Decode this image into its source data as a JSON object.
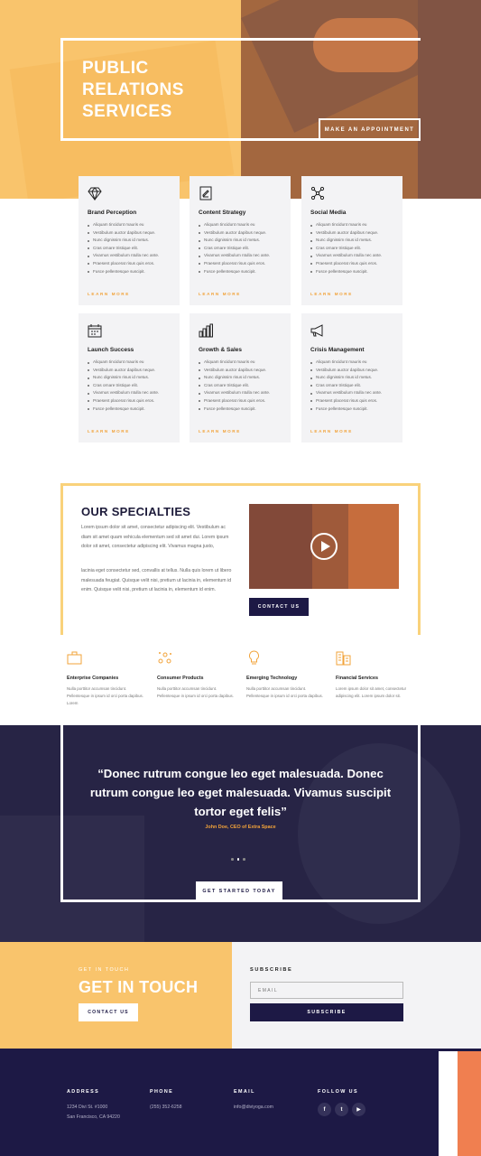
{
  "hero": {
    "title": "PUBLIC RELATIONS SERVICES",
    "cta": "MAKE AN APPOINTMENT"
  },
  "services": [
    {
      "title": "Brand Perception",
      "icon": "diamond-icon",
      "items": [
        "Aliquam tincidunt mauris eu",
        "Vestibulum auctor dapibus neque.",
        "Nunc dignissim risus id metus.",
        "Cras ornare tristique elit.",
        "Vivamus vestibulum ntulla nec ante.",
        "Praesent placerat risus quis eros.",
        "Fusce pellentesque suscipit."
      ],
      "more": "LEARN MORE"
    },
    {
      "title": "Content Strategy",
      "icon": "document-icon",
      "items": [
        "Aliquam tincidunt mauris eu",
        "Vestibulum auctor dapibus neque.",
        "Nunc dignissim risus id metus.",
        "Cras ornare tristique elit.",
        "Vivamus vestibulum ntulla nec ante.",
        "Praesent placerat risus quis eros.",
        "Fusce pellentesque suscipit."
      ],
      "more": "LEARN MORE"
    },
    {
      "title": "Social Media",
      "icon": "network-icon",
      "items": [
        "Aliquam tincidunt mauris eu",
        "Vestibulum auctor dapibus neque.",
        "Nunc dignissim risus id metus.",
        "Cras ornare tristique elit.",
        "Vivamus vestibulum ntulla nec ante.",
        "Praesent placerat risus quis eros.",
        "Fusce pellentesque suscipit."
      ],
      "more": "LEARN MORE"
    },
    {
      "title": "Launch Success",
      "icon": "calendar-icon",
      "items": [
        "Aliquam tincidunt mauris eu",
        "Vestibulum auctor dapibus neque.",
        "Nunc dignissim risus id metus.",
        "Cras ornare tristique elit.",
        "Vivamus vestibulum ntulla nec ante.",
        "Praesent placerat risus quis eros.",
        "Fusce pellentesque suscipit."
      ],
      "more": "LEARN MORE"
    },
    {
      "title": "Growth & Sales",
      "icon": "bar-chart-icon",
      "items": [
        "Aliquam tincidunt mauris eu",
        "Vestibulum auctor dapibus neque.",
        "Nunc dignissim risus id metus.",
        "Cras ornare tristique elit.",
        "Vivamus vestibulum ntulla nec ante.",
        "Praesent placerat risus quis eros.",
        "Fusce pellentesque suscipit."
      ],
      "more": "LEARN MORE"
    },
    {
      "title": "Crisis Management",
      "icon": "megaphone-icon",
      "items": [
        "Aliquam tincidunt mauris eu",
        "Vestibulum auctor dapibus neque.",
        "Nunc dignissim risus id metus.",
        "Cras ornare tristique elit.",
        "Vivamus vestibulum ntulla nec ante.",
        "Praesent placerat risus quis eros.",
        "Fusce pellentesque suscipit."
      ],
      "more": "LEARN MORE"
    }
  ],
  "specialties": {
    "title": "OUR SPECIALTIES",
    "p1": "Lorem ipsum dolor sit amet, consectetur adipiscing elit. Vestibulum ac diam sit amet quam vehicula elementum sed sit amet dui. Lorem ipsum dolor sit amet, consectetur adipiscing elit. Vivamus magna justo,",
    "p2": "lacinia eget consectetur sed, convallis at tellus. Nulla quis lorem ut libero malesuada feugiat. Quisque velit nisi, pretium ut lacinia in, elementum id enim. Quisque velit nisi, pretium ut lacinia in, elementum id enim.",
    "contact": "CONTACT US"
  },
  "features": [
    {
      "title": "Enterprise Companies",
      "icon": "briefcase-icon",
      "text": "Nulla porttitor accumsan tincidunt. Pellentesque in ipsum id orci porta dapibus. Lorem"
    },
    {
      "title": "Consumer Products",
      "icon": "molecule-icon",
      "text": "Nulla porttitor accumsan tincidunt. Pellentesque in ipsum id orci porta dapibus."
    },
    {
      "title": "Emerging Technology",
      "icon": "lightbulb-icon",
      "text": "Nulla porttitor accumsan tincidunt. Pellentesque in ipsum id orci porta dapibus."
    },
    {
      "title": "Financial Services",
      "icon": "buildings-icon",
      "text": "Lorem ipsum dolor sit amet, consectetur adipiscing elit. Lorem ipsum dolor sit."
    }
  ],
  "testimonial": {
    "quote": "“Donec rutrum congue leo eget malesuada. Donec rutrum congue leo eget malesuada. Vivamus suscipit tortor eget felis”",
    "author": "John Doe, CEO of Extra Space",
    "cta": "GET STARTED TODAY"
  },
  "get_in_touch": {
    "eyebrow": "GET IN TOUCH",
    "title": "GET IN TOUCH",
    "cta": "CONTACT US"
  },
  "subscribe": {
    "title": "SUBSCRIBE",
    "placeholder": "EMAIL",
    "button": "SUBSCRIBE"
  },
  "footer": {
    "address_label": "ADDRESS",
    "address_line1": "1234 Divi St. #1000",
    "address_line2": "San Francisco, CA 94220",
    "phone_label": "PHONE",
    "phone": "(255) 352-6258",
    "email_label": "EMAIL",
    "email": "info@diviyoga.com",
    "follow_label": "FOLLOW US",
    "socials": [
      "f",
      "t",
      "▶"
    ]
  },
  "colors": {
    "accent_yellow": "#f9c46c",
    "accent_orange": "#f2a33a",
    "navy": "#1d1945"
  }
}
